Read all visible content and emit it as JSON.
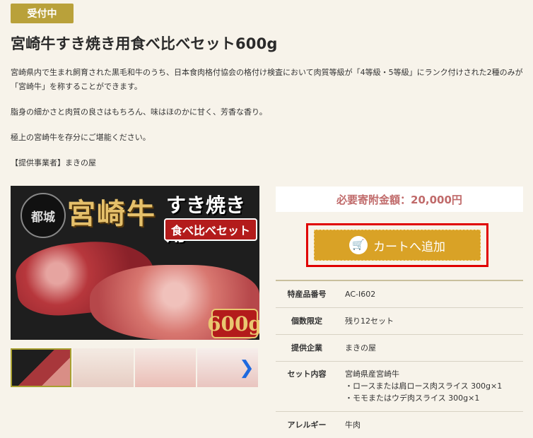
{
  "status_badge": "受付中",
  "title": "宮崎牛すき焼き用食べ比べセット600g",
  "description": [
    "宮崎県内で生まれ飼育された黒毛和牛のうち、日本食肉格付協会の格付け検査において肉質等級が「4等級・5等級」にランク付けされた2種のみが「宮崎牛」を称することができます。",
    "脂身の細かさと肉質の良さはもちろん、味はほのかに甘く、芳香な香り。",
    "極上の宮崎牛を存分にご堪能ください。",
    "【提供事業者】まきの屋"
  ],
  "hero": {
    "logo_text": "都城",
    "brand": "宮崎牛",
    "sub": "すき焼き用",
    "band": "食べ比べセット",
    "weight": "600g"
  },
  "price": "必要寄附金額：20,000円",
  "cart_button": "カートへ追加",
  "cart_icon": "cart-icon",
  "specs": {
    "product_no": {
      "label": "特産品番号",
      "value": "AC-I602"
    },
    "limit": {
      "label": "個数限定",
      "value": "残り12セット"
    },
    "company": {
      "label": "提供企業",
      "value": "まきの屋"
    },
    "contents": {
      "label": "セット内容",
      "lines": [
        "宮崎県産宮崎牛",
        "・ロースまたは肩ロース肉スライス 300g×1",
        "・モモまたはウデ肉スライス 300g×1"
      ]
    },
    "allergy": {
      "label": "アレルギー",
      "value": "牛肉"
    }
  },
  "colors": {
    "badge": "#b9a13a",
    "cart": "#d9a226",
    "highlight": "#e00000",
    "price": "#c06a6a"
  }
}
